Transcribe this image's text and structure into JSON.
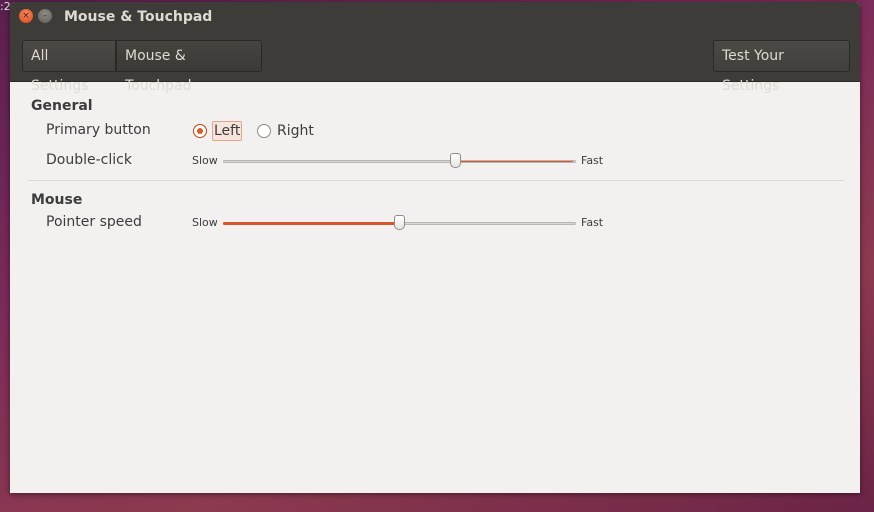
{
  "desktop": {
    "clock_fragment": ":2"
  },
  "window": {
    "title": "Mouse & Touchpad",
    "close_glyph": "×",
    "minimize_glyph": "–"
  },
  "toolbar": {
    "all_settings": "All Settings",
    "current_panel": "Mouse & Touchpad",
    "test_settings": "Test Your Settings"
  },
  "general": {
    "title": "General",
    "primary_button": {
      "label": "Primary button",
      "options": [
        "Left",
        "Right"
      ],
      "selected": "Left"
    },
    "double_click": {
      "label": "Double-click",
      "min_label": "Slow",
      "max_label": "Fast",
      "value_fraction": 0.66
    }
  },
  "mouse": {
    "title": "Mouse",
    "pointer_speed": {
      "label": "Pointer speed",
      "min_label": "Slow",
      "max_label": "Fast",
      "value_fraction": 0.5
    }
  },
  "colors": {
    "accent": "#e05a25",
    "titlebar": "#3d3c38",
    "window_bg": "#f2f1f0"
  }
}
